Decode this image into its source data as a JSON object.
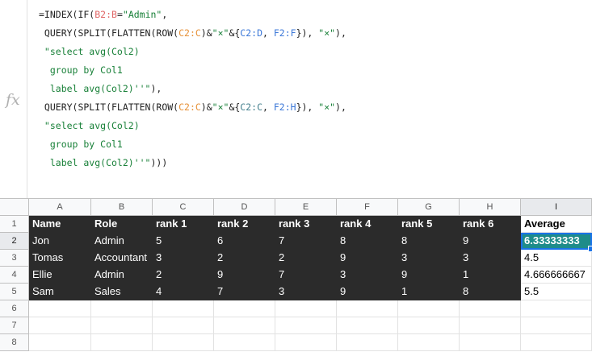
{
  "formula_bar": {
    "fx_label": "fx",
    "lines": [
      [
        {
          "t": "=INDEX(IF(",
          "c": ""
        },
        {
          "t": "B2:B",
          "c": "rng-red"
        },
        {
          "t": "=",
          "c": ""
        },
        {
          "t": "\"Admin\"",
          "c": "str"
        },
        {
          "t": ",",
          "c": ""
        }
      ],
      [
        {
          "t": " QUERY(SPLIT(FLATTEN(ROW(",
          "c": ""
        },
        {
          "t": "C2:C",
          "c": "rng-orange"
        },
        {
          "t": ")&",
          "c": ""
        },
        {
          "t": "\"×\"",
          "c": "str"
        },
        {
          "t": "&{",
          "c": ""
        },
        {
          "t": "C2:D",
          "c": "rng-blue"
        },
        {
          "t": ", ",
          "c": ""
        },
        {
          "t": "F2:F",
          "c": "rng-blue"
        },
        {
          "t": "}), ",
          "c": ""
        },
        {
          "t": "\"×\"",
          "c": "str"
        },
        {
          "t": "),",
          "c": ""
        }
      ],
      [
        {
          "t": " \"select avg(Col2)",
          "c": "str"
        }
      ],
      [
        {
          "t": "  group by Col1",
          "c": "str"
        }
      ],
      [
        {
          "t": "  label avg(Col2)''\"",
          "c": "str"
        },
        {
          "t": "),",
          "c": ""
        }
      ],
      [
        {
          "t": " QUERY(SPLIT(FLATTEN(ROW(",
          "c": ""
        },
        {
          "t": "C2:C",
          "c": "rng-orange"
        },
        {
          "t": ")&",
          "c": ""
        },
        {
          "t": "\"×\"",
          "c": "str"
        },
        {
          "t": "&{",
          "c": ""
        },
        {
          "t": "C2:C",
          "c": "rng-teal"
        },
        {
          "t": ", ",
          "c": ""
        },
        {
          "t": "F2:H",
          "c": "rng-blue"
        },
        {
          "t": "}), ",
          "c": ""
        },
        {
          "t": "\"×\"",
          "c": "str"
        },
        {
          "t": "),",
          "c": ""
        }
      ],
      [
        {
          "t": " \"select avg(Col2)",
          "c": "str"
        }
      ],
      [
        {
          "t": "  group by Col1",
          "c": "str"
        }
      ],
      [
        {
          "t": "  label avg(Col2)''\"",
          "c": "str"
        },
        {
          "t": ")))",
          "c": ""
        }
      ]
    ]
  },
  "sheet": {
    "columns": [
      "A",
      "B",
      "C",
      "D",
      "E",
      "F",
      "G",
      "H",
      "I"
    ],
    "selected_column": "I",
    "selected_row": "2",
    "rows": [
      "1",
      "2",
      "3",
      "4",
      "5",
      "6",
      "7",
      "8"
    ],
    "data": [
      [
        "Name",
        "Role",
        "rank 1",
        "rank 2",
        "rank 3",
        "rank 4",
        "rank 5",
        "rank 6",
        "Average"
      ],
      [
        "Jon",
        "Admin",
        "5",
        "6",
        "7",
        "8",
        "8",
        "9",
        "6.33333333"
      ],
      [
        "Tomas",
        "Accountant",
        "3",
        "2",
        "2",
        "9",
        "3",
        "3",
        "4.5"
      ],
      [
        "Ellie",
        "Admin",
        "2",
        "9",
        "7",
        "3",
        "9",
        "1",
        "4.666666667"
      ],
      [
        "Sam",
        "Sales",
        "4",
        "7",
        "3",
        "9",
        "1",
        "8",
        "5.5"
      ]
    ]
  }
}
